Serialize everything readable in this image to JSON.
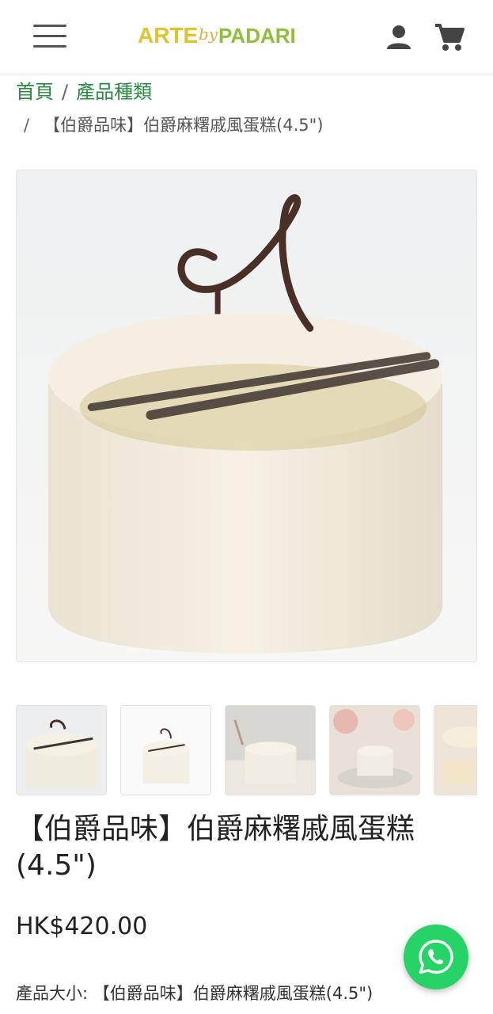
{
  "header": {
    "menu_icon": "hamburger-menu-icon",
    "logo": {
      "part1": "ARTE",
      "part2": "by",
      "part3": "PADARIA"
    },
    "user_icon": "user-icon",
    "cart_icon": "shopping-cart-icon"
  },
  "breadcrumb": {
    "home": "首頁",
    "separator": "/",
    "category": "產品種類",
    "current": "【伯爵品味】伯爵麻糬戚風蛋糕(4.5\")"
  },
  "product": {
    "title": "【伯爵品味】伯爵麻糬戚風蛋糕(4.5\")",
    "price": "HK$420.00",
    "variant_label": "產品大小:",
    "variant_value": "【伯爵品味】伯爵麻糬戚風蛋糕(4.5\")"
  },
  "gallery": {
    "thumbnails": [
      "cake-front-view",
      "cake-white-background",
      "cake-grey-background",
      "cake-floral-table",
      "cake-slices"
    ]
  },
  "whatsapp": {
    "icon": "whatsapp-icon"
  },
  "colors": {
    "brand_green": "#2a8a44",
    "logo_yellow": "#e2c42a",
    "logo_green": "#8fbf3a",
    "whatsapp_green": "#25d366"
  }
}
